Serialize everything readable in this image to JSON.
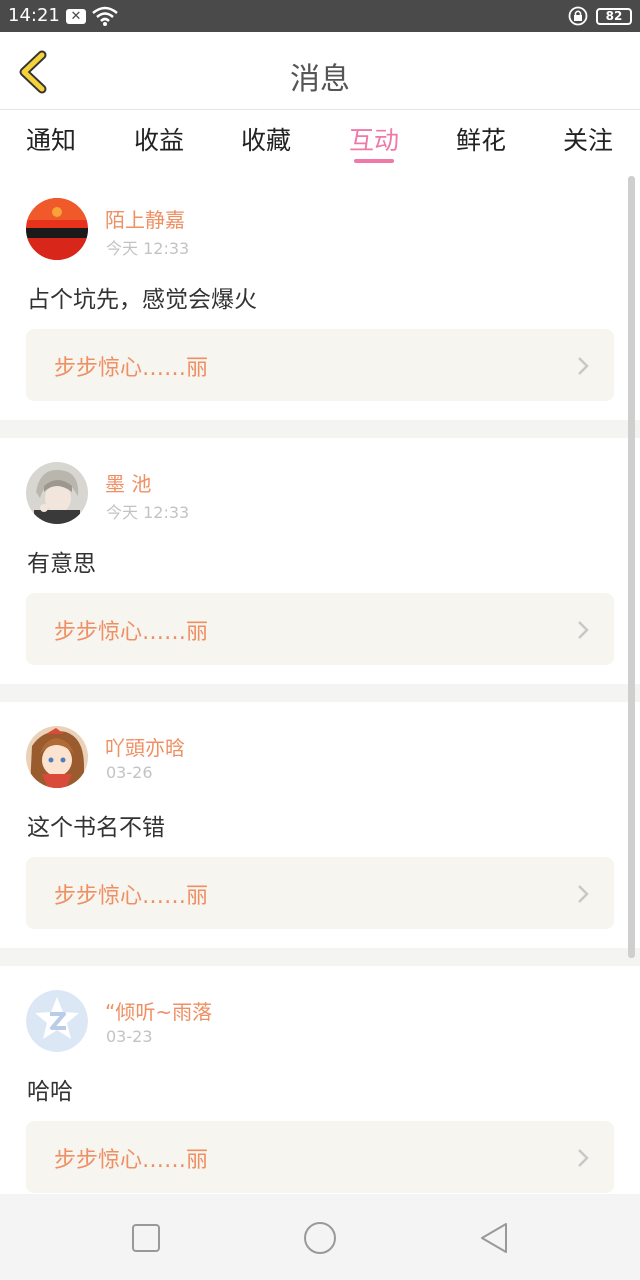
{
  "status_bar": {
    "time": "14:21",
    "battery": "82",
    "icons": [
      "close-notification-icon",
      "wifi-icon",
      "lock-rotation-icon",
      "battery-icon"
    ]
  },
  "header": {
    "title": "消息",
    "back_icon": "chevron-left-icon"
  },
  "tabs": [
    {
      "label": "通知",
      "active": false
    },
    {
      "label": "收益",
      "active": false
    },
    {
      "label": "收藏",
      "active": false
    },
    {
      "label": "互动",
      "active": true
    },
    {
      "label": "鲜花",
      "active": false
    },
    {
      "label": "关注",
      "active": false
    }
  ],
  "messages": [
    {
      "username": "陌上静嘉",
      "time": "今天 12:33",
      "comment": "占个坑先，感觉会爆火",
      "book": "步步惊心……丽"
    },
    {
      "username": "墨 池",
      "time": "今天 12:33",
      "comment": "有意思",
      "book": "步步惊心……丽"
    },
    {
      "username": "吖頭亦晗",
      "time": "03-26",
      "comment": "这个书名不错",
      "book": "步步惊心……丽"
    },
    {
      "username": "“倾听~雨落",
      "time": "03-23",
      "comment": "哈哈",
      "book": "步步惊心……丽"
    }
  ],
  "nav_bar": {
    "icons": [
      "recent-apps-icon",
      "home-icon",
      "back-icon"
    ]
  },
  "colors": {
    "accent_pink": "#ef7aa8",
    "username_orange": "#ef8f63",
    "back_arrow_yellow": "#f5d23a",
    "link_bg": "#f6f5ef"
  }
}
